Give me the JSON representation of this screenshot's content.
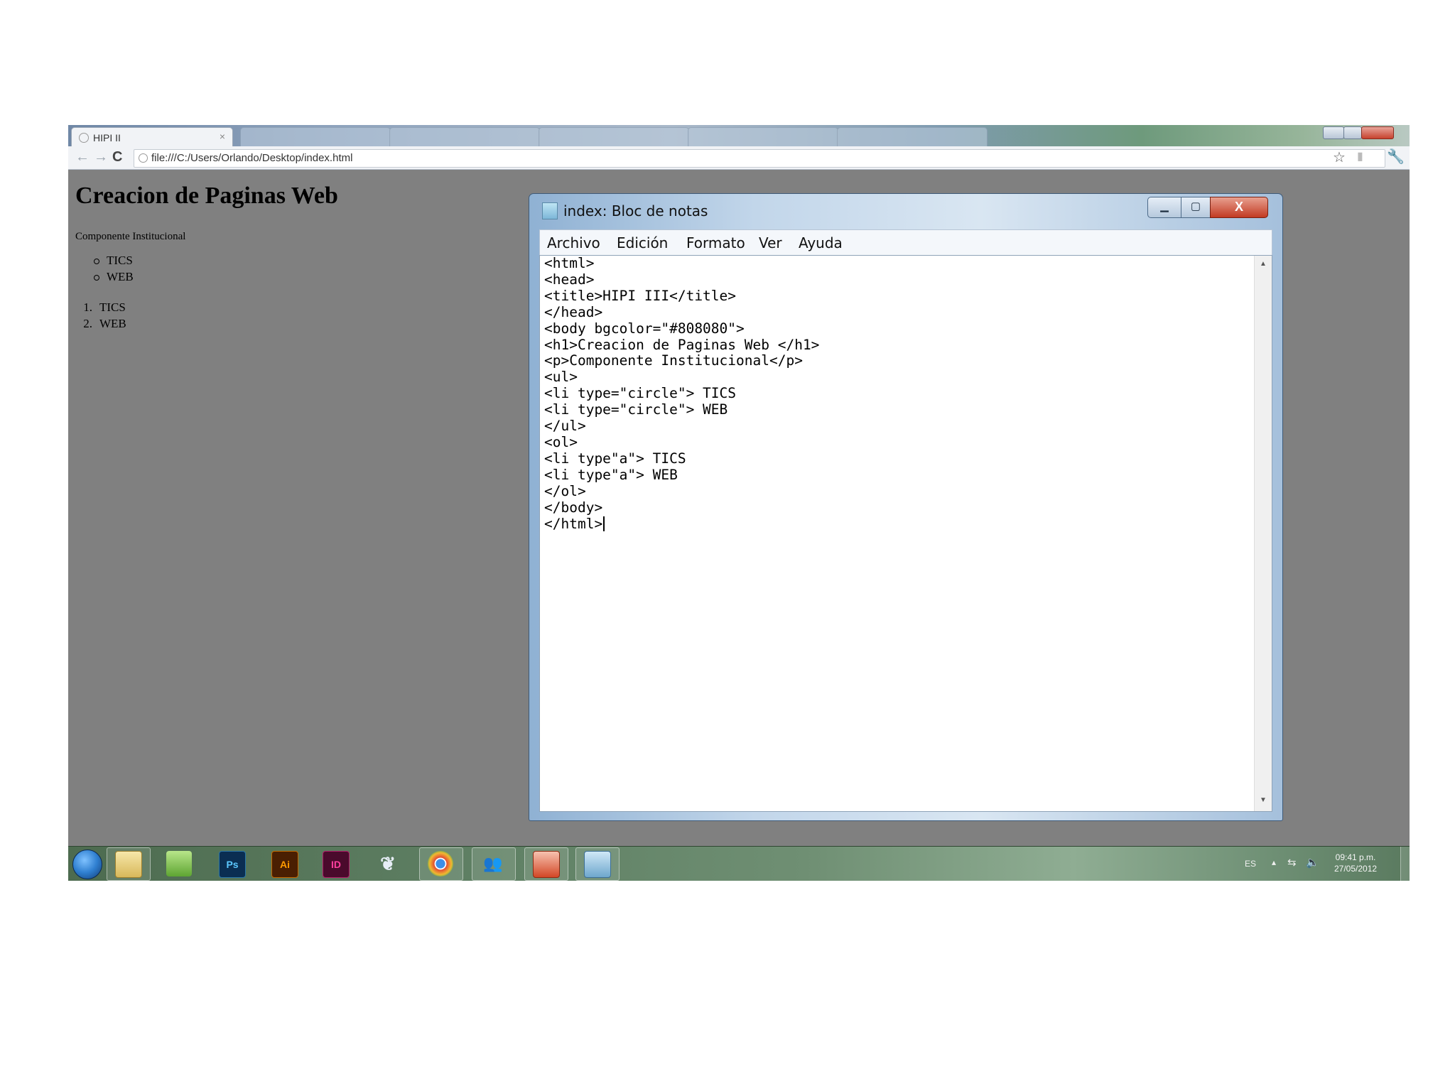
{
  "browser": {
    "active_tab_title": "HIPI II",
    "url": "file:///C:/Users/Orlando/Desktop/index.html",
    "close_glyph": "×"
  },
  "webpage": {
    "h1": "Creacion de Paginas Web",
    "paragraph": "Componente Institucional",
    "unordered_list": [
      "TICS",
      "WEB"
    ],
    "ordered_list": [
      {
        "num": "1.",
        "text": "TICS"
      },
      {
        "num": "2.",
        "text": "WEB"
      }
    ],
    "background_color": "#808080"
  },
  "notepad": {
    "title": "index: Bloc de notas",
    "menu": [
      "Archivo",
      "Edición",
      "Formato",
      "Ver",
      "Ayuda"
    ],
    "close_glyph": "X",
    "content": "<html>\n<head>\n<title>HIPI III</title>\n</head>\n<body bgcolor=\"#808080\">\n<h1>Creacion de Paginas Web </h1>\n<p>Componente Institucional</p>\n<ul>\n<li type=\"circle\"> TICS\n<li type=\"circle\"> WEB\n</ul>\n<ol>\n<li type\"a\"> TICS\n<li type\"a\"> WEB\n</ol>\n</body>\n</html>"
  },
  "taskbar": {
    "icons": [
      "start-orb",
      "windows-explorer",
      "evernote",
      "photoshop",
      "illustrator",
      "indesign",
      "feather",
      "google-chrome",
      "people",
      "powerpoint",
      "notepad"
    ],
    "photoshop_label": "Ps",
    "illustrator_label": "Ai",
    "indesign_label": "ID",
    "language": "ES",
    "time": "09:41 p.m.",
    "date": "27/05/2012"
  }
}
